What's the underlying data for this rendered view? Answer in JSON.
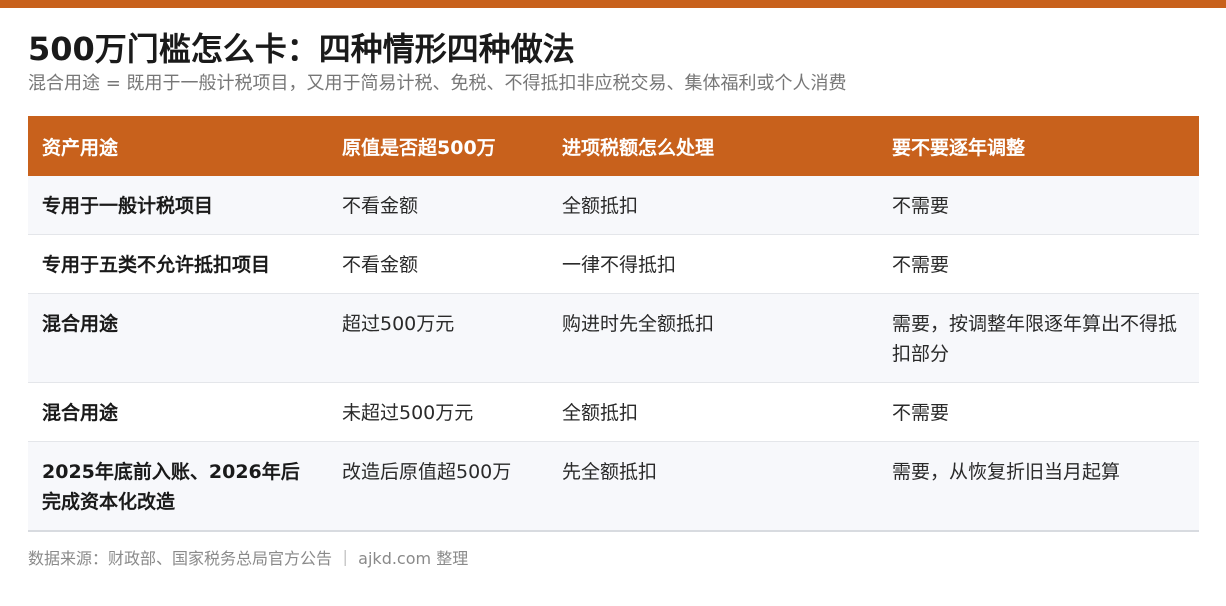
{
  "title": "500万门槛怎么卡：四种情形四种做法",
  "subtitle": "混合用途 = 既用于一般计税项目，又用于简易计税、免税、不得抵扣非应税交易、集体福利或个人消费",
  "table": {
    "headers": [
      "资产用途",
      "原值是否超500万",
      "进项税额怎么处理",
      "要不要逐年调整"
    ],
    "rows": [
      [
        "专用于一般计税项目",
        "不看金额",
        "全额抵扣",
        "不需要"
      ],
      [
        "专用于五类不允许抵扣项目",
        "不看金额",
        "一律不得抵扣",
        "不需要"
      ],
      [
        "混合用途",
        "超过500万元",
        "购进时先全额抵扣",
        "需要，按调整年限逐年算出不得抵扣部分"
      ],
      [
        "混合用途",
        "未超过500万元",
        "全额抵扣",
        "不需要"
      ],
      [
        "2025年底前入账、2026年后完成资本化改造",
        "改造后原值超500万",
        "先全额抵扣",
        "需要，从恢复折旧当月起算"
      ]
    ]
  },
  "footer": "数据来源：财政部、国家税务总局官方公告 ｜ ajkd.com 整理",
  "colors": {
    "accent": "#c8611c"
  }
}
